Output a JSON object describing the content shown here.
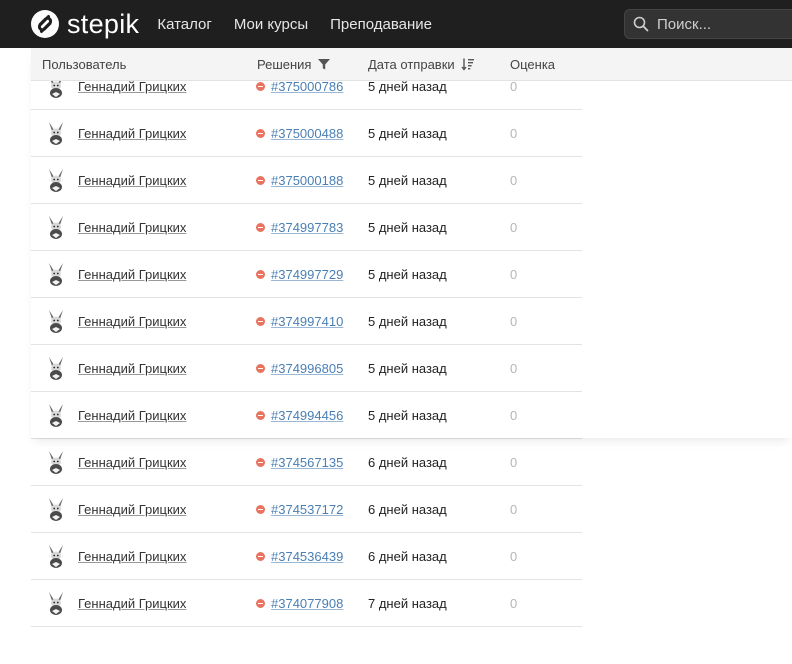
{
  "navbar": {
    "brand": "stepik",
    "links": [
      "Каталог",
      "Мои курсы",
      "Преподавание"
    ],
    "search_placeholder": "Поиск..."
  },
  "table": {
    "headers": {
      "user": "Пользователь",
      "solutions": "Решения",
      "date": "Дата отправки",
      "score": "Оценка"
    },
    "rows": [
      {
        "user": "Геннадий Грицких",
        "solution": "#375000786",
        "date": "5 дней назад",
        "score": "0"
      },
      {
        "user": "Геннадий Грицких",
        "solution": "#375000488",
        "date": "5 дней назад",
        "score": "0"
      },
      {
        "user": "Геннадий Грицких",
        "solution": "#375000188",
        "date": "5 дней назад",
        "score": "0"
      },
      {
        "user": "Геннадий Грицких",
        "solution": "#374997783",
        "date": "5 дней назад",
        "score": "0"
      },
      {
        "user": "Геннадий Грицких",
        "solution": "#374997729",
        "date": "5 дней назад",
        "score": "0"
      },
      {
        "user": "Геннадий Грицких",
        "solution": "#374997410",
        "date": "5 дней назад",
        "score": "0"
      },
      {
        "user": "Геннадий Грицких",
        "solution": "#374996805",
        "date": "5 дней назад",
        "score": "0"
      },
      {
        "user": "Геннадий Грицких",
        "solution": "#374994456",
        "date": "5 дней назад",
        "score": "0"
      },
      {
        "user": "Геннадий Грицких",
        "solution": "#374567135",
        "date": "6 дней назад",
        "score": "0"
      },
      {
        "user": "Геннадий Грицких",
        "solution": "#374537172",
        "date": "6 дней назад",
        "score": "0"
      },
      {
        "user": "Геннадий Грицких",
        "solution": "#374536439",
        "date": "6 дней назад",
        "score": "0"
      },
      {
        "user": "Геннадий Грицких",
        "solution": "#374077908",
        "date": "7 дней назад",
        "score": "0"
      }
    ]
  },
  "colors": {
    "navbar_bg": "#1f1f1f",
    "link": "#4a7fb5",
    "status_wrong": "#e8735f",
    "score": "#b6b6b6"
  },
  "icons": {
    "logo": "stepik-logo-icon",
    "search": "search-icon",
    "filter": "filter-icon",
    "sort": "sort-descending-icon",
    "status": "wrong-status-icon",
    "avatar": "user-avatar"
  }
}
